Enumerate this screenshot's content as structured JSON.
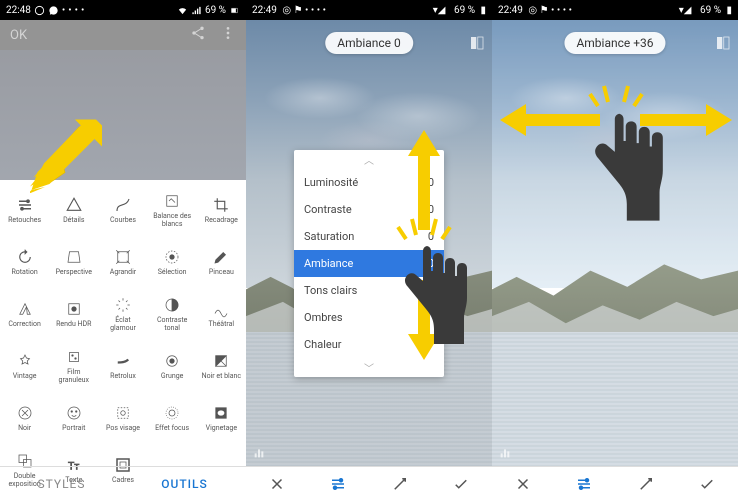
{
  "status": {
    "time1": "22:48",
    "time2": "22:49",
    "time3": "22:49",
    "battery": "69 %"
  },
  "screen1": {
    "ok": "OK",
    "tools": [
      [
        "Retouches",
        "Détails",
        "Courbes",
        "Balance des\nblancs",
        "Recadrage"
      ],
      [
        "Rotation",
        "Perspective",
        "Agrandir",
        "Sélection",
        "Pinceau"
      ],
      [
        "Correction",
        "Rendu HDR",
        "Éclat\nglamour",
        "Contraste\ntonal",
        "Théâtral"
      ],
      [
        "Vintage",
        "Film\ngranuleux",
        "Retrolux",
        "Grunge",
        "Noir et blanc"
      ],
      [
        "Noir",
        "Portrait",
        "Pos visage",
        "Effet focus",
        "Vignetage"
      ],
      [
        "Double\nexposition",
        "Texte",
        "Cadres",
        "",
        ""
      ]
    ],
    "tabs": {
      "styles": "STYLES",
      "outils": "OUTILS"
    }
  },
  "screen2": {
    "chip": "Ambiance 0",
    "adjustments": [
      {
        "label": "Luminosité",
        "val": "0"
      },
      {
        "label": "Contraste",
        "val": "0"
      },
      {
        "label": "Saturation",
        "val": "0"
      },
      {
        "label": "Ambiance",
        "val": "0"
      },
      {
        "label": "Tons clairs",
        "val": ""
      },
      {
        "label": "Ombres",
        "val": ""
      },
      {
        "label": "Chaleur",
        "val": ""
      }
    ],
    "selected_index": 3
  },
  "screen3": {
    "chip": "Ambiance +36"
  },
  "colors": {
    "accent": "#1976d2",
    "yellow": "#f7cd00"
  }
}
